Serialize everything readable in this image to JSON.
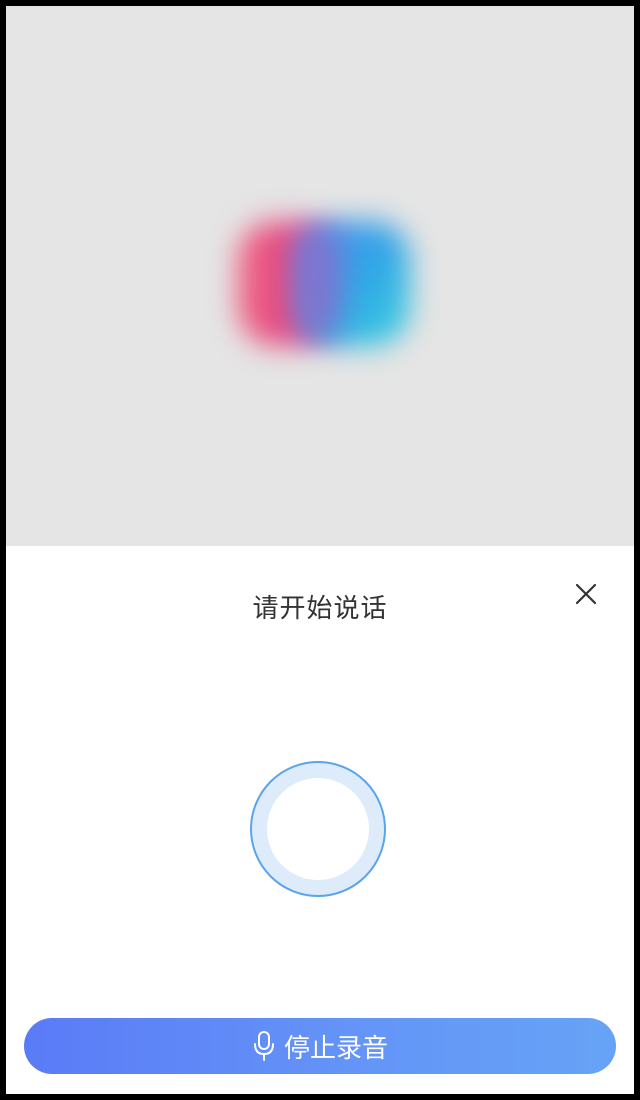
{
  "dialog": {
    "title": "请开始说话",
    "close_icon": "close-icon",
    "stop_button_label": "停止录音",
    "stop_button_icon": "microphone-icon"
  },
  "colors": {
    "preview_bg": "#e5e5e5",
    "accent_blue": "#5a7bf7",
    "ring_border": "#5aa4ee",
    "ring_fill": "#deebfb",
    "title_text": "#333333"
  }
}
